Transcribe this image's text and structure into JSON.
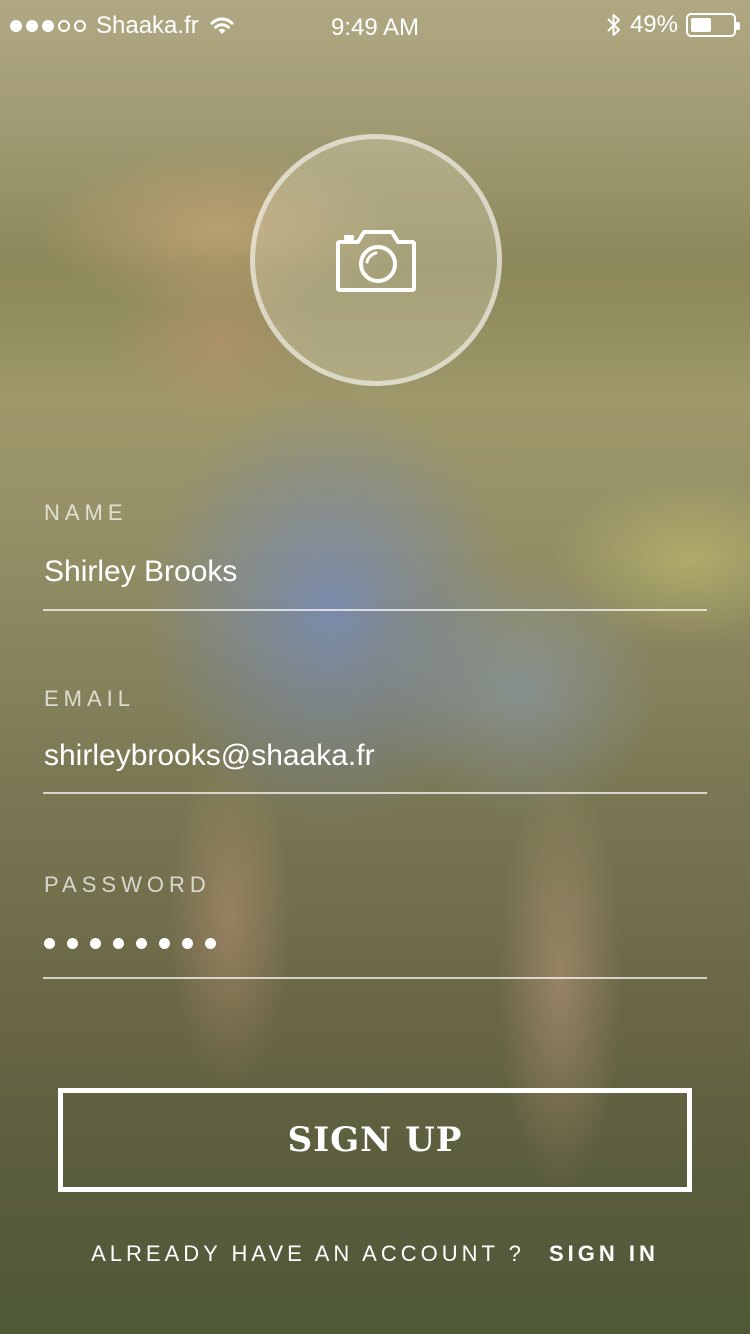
{
  "status_bar": {
    "signal_bars_filled": 3,
    "signal_bars_total": 5,
    "carrier": "Shaaka.fr",
    "time": "9:49 AM",
    "battery_percent_text": "49%",
    "battery_level": 0.49
  },
  "avatar": {
    "icon": "camera-icon"
  },
  "form": {
    "name": {
      "label": "NAME",
      "value": "Shirley Brooks"
    },
    "email": {
      "label": "EMAIL",
      "value": "shirleybrooks@shaaka.fr"
    },
    "password": {
      "label": "PASSWORD",
      "masked_length": 8
    }
  },
  "signup_button": {
    "label": "SIGN UP"
  },
  "signin_prompt": {
    "text": "ALREADY HAVE AN ACCOUNT ?",
    "link": "SIGN IN"
  },
  "colors": {
    "text": "#ffffff",
    "underline": "#ffffff"
  }
}
